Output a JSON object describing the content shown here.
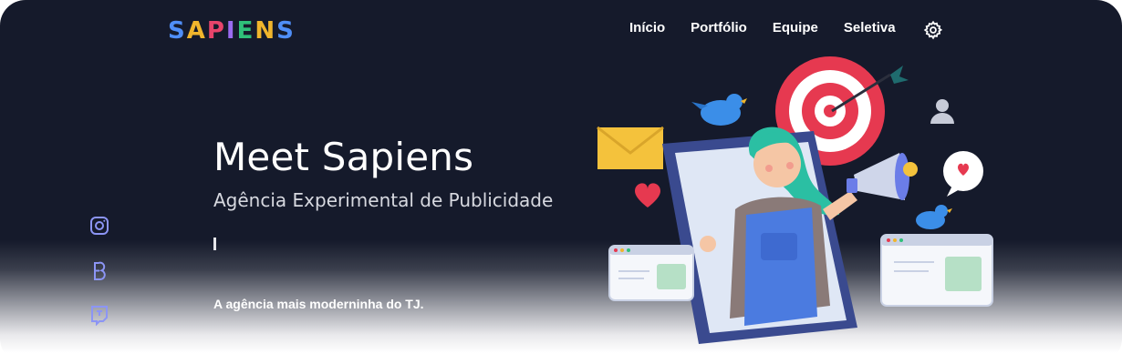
{
  "brand": {
    "name": "SAPIENS",
    "letters": [
      {
        "ch": "S",
        "color": "#4f8ef7"
      },
      {
        "ch": "A",
        "color": "#f0b52c"
      },
      {
        "ch": "P",
        "color": "#e8446b"
      },
      {
        "ch": "I",
        "color": "#9b6cf0"
      },
      {
        "ch": "E",
        "color": "#2fc07a"
      },
      {
        "ch": "N",
        "color": "#f0b52c"
      },
      {
        "ch": "S",
        "color": "#4f8ef7"
      }
    ]
  },
  "nav": {
    "items": [
      "Início",
      "Portfólio",
      "Equipe",
      "Seletiva"
    ],
    "settings_icon": "gear-icon"
  },
  "hero": {
    "title": "Meet Sapiens",
    "subtitle": "Agência Experimental de Publicidade",
    "tagline": "A agência mais moderninha do TJ."
  },
  "social": [
    "instagram-icon",
    "behance-icon",
    "twitch-icon"
  ],
  "colors": {
    "background": "#151a2b",
    "text": "#ffffff",
    "social_icon": "#8c95f5"
  }
}
